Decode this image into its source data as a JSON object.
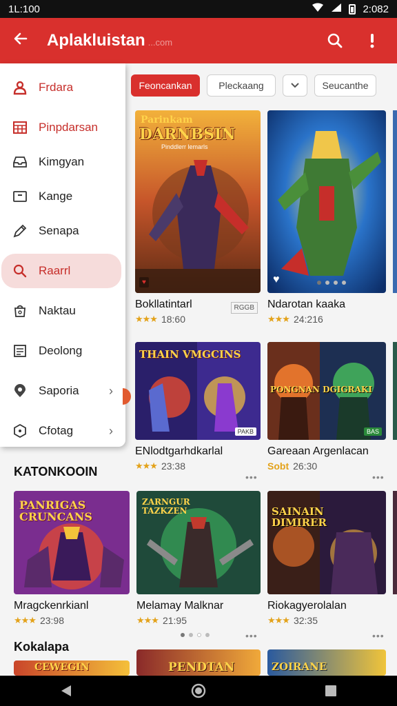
{
  "status": {
    "time": "1L:100",
    "clock": "2:082"
  },
  "appbar": {
    "title": "Aplakluistan",
    "subtitle_faint": "...com"
  },
  "chips": [
    "Feoncankan",
    "Pleckaang",
    "Seucanthe"
  ],
  "drawer": {
    "items": [
      {
        "label": "Frdara",
        "icon": "user-group-icon"
      },
      {
        "label": "Pinpdarsan",
        "icon": "calendar-grid-icon"
      },
      {
        "label": "Kimgyan",
        "icon": "inbox-tray-icon"
      },
      {
        "label": "Kange",
        "icon": "window-icon"
      },
      {
        "label": "Senapa",
        "icon": "pencil-icon"
      },
      {
        "label": "Raarrl",
        "icon": "search-icon"
      },
      {
        "label": "Naktau",
        "icon": "bag-icon"
      },
      {
        "label": "Deolong",
        "icon": "document-icon"
      },
      {
        "label": "Saporia",
        "icon": "location-pin-icon"
      },
      {
        "label": "Cfotag",
        "icon": "hexagon-icon"
      }
    ]
  },
  "grid_top": [
    {
      "name": "Bokllatintarl",
      "rating": "18:60",
      "banner": "DARNBSIN",
      "banner_top": "Parinkam",
      "sub": "Pinddlerr lemarls",
      "badge": "RGGB",
      "colors": [
        "#7a3b1c",
        "#c6552a",
        "#f2b13b"
      ]
    },
    {
      "name": "Ndarotan kaaka",
      "rating": "24:216",
      "colors": [
        "#2a73c9",
        "#f0c64a",
        "#4a8f3a"
      ]
    }
  ],
  "grid_mid": [
    {
      "name": "ENlodtgarhdkarlal",
      "rating": "23:38",
      "banner": "THAIN VMGCINS",
      "badge": "PAKB",
      "colors": [
        "#3d2a8f",
        "#e34a2f",
        "#f6c23f"
      ]
    },
    {
      "name": "Gareaan Argenlacan",
      "rating_prefix": "Sobt",
      "rating": "26:30",
      "banner": "PONGNAN DGIGRAKI",
      "badge": "BAS",
      "colors": [
        "#1d2f52",
        "#e2732c",
        "#3fa35a"
      ]
    }
  ],
  "section1": "KATONKOOIN",
  "grid_low": [
    {
      "name": "Mragckenrkianl",
      "rating": "23:98",
      "banner": "PANRIGAS CRUNCANS",
      "colors": [
        "#7a2d8f",
        "#e84b2b",
        "#f4c43a"
      ]
    },
    {
      "name": "Melamay Malknar",
      "rating": "21:95",
      "banner": "ZARNGUR TAZKZEN",
      "colors": [
        "#1f4a3a",
        "#3fbf63",
        "#c23a2d"
      ]
    },
    {
      "name": "Riokagyerolalan",
      "rating": "32:35",
      "banner": "SAINAIN DIMIRER",
      "colors": [
        "#2b1a3c",
        "#d86a2a",
        "#f2b040"
      ]
    }
  ],
  "section2": "Kokalapa",
  "grid_bottom": [
    {
      "banner": "CEWEGIN",
      "colors": [
        "#c9452a",
        "#f4c03a"
      ]
    },
    {
      "banner": "PENDTAN",
      "colors": [
        "#8a2a2a",
        "#f0a93a"
      ]
    },
    {
      "banner": "ZOIRANE",
      "colors": [
        "#2a5a9f",
        "#f0c43a"
      ]
    }
  ]
}
